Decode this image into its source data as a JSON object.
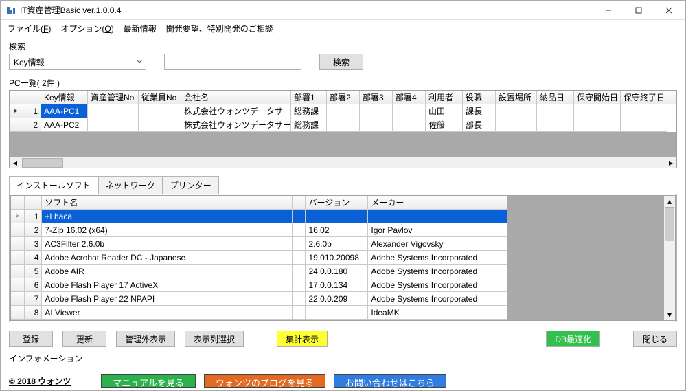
{
  "window": {
    "title": "IT資産管理Basic ver.1.0.0.4"
  },
  "menu": {
    "file": "ファイル(F)",
    "option": "オプション(O)",
    "latest": "最新情報",
    "request": "開発要望、特別開発のご相談"
  },
  "search": {
    "label": "検索",
    "combo_value": "Key情報",
    "text_value": "",
    "button": "検索"
  },
  "pc_list": {
    "title": "PC一覧( 2件 )",
    "columns": [
      "Key情報",
      "資産管理No",
      "従業員No",
      "会社名",
      "部署1",
      "部署2",
      "部署3",
      "部署4",
      "利用者",
      "役職",
      "設置場所",
      "納品日",
      "保守開始日",
      "保守終了日"
    ],
    "rows": [
      {
        "n": "1",
        "key": "AAA-PC1",
        "asset": "",
        "emp": "",
        "company": "株式会社ウォンツデータサービス",
        "d1": "総務課",
        "d2": "",
        "d3": "",
        "d4": "",
        "user": "山田",
        "role": "課長",
        "loc": "",
        "deliv": "",
        "hs": "",
        "he": ""
      },
      {
        "n": "2",
        "key": "AAA-PC2",
        "asset": "",
        "emp": "",
        "company": "株式会社ウォンツデータサービス",
        "d1": "総務課",
        "d2": "",
        "d3": "",
        "d4": "",
        "user": "佐藤",
        "role": "部長",
        "loc": "",
        "deliv": "",
        "hs": "",
        "he": ""
      }
    ]
  },
  "tabs": {
    "installed": "インストールソフト",
    "network": "ネットワーク",
    "printer": "プリンター"
  },
  "software": {
    "columns": [
      "ソフト名",
      "",
      "バージョン",
      "メーカー"
    ],
    "rows": [
      {
        "n": "1",
        "name": "+Lhaca",
        "ver": "",
        "maker": ""
      },
      {
        "n": "2",
        "name": "7-Zip 16.02 (x64)",
        "ver": "16.02",
        "maker": "Igor Pavlov"
      },
      {
        "n": "3",
        "name": "AC3Filter 2.6.0b",
        "ver": "2.6.0b",
        "maker": "Alexander Vigovsky"
      },
      {
        "n": "4",
        "name": "Adobe Acrobat Reader DC - Japanese",
        "ver": "19.010.20098",
        "maker": "Adobe Systems Incorporated"
      },
      {
        "n": "5",
        "name": "Adobe AIR",
        "ver": "24.0.0.180",
        "maker": "Adobe Systems Incorporated"
      },
      {
        "n": "6",
        "name": "Adobe Flash Player 17 ActiveX",
        "ver": "17.0.0.134",
        "maker": "Adobe Systems Incorporated"
      },
      {
        "n": "7",
        "name": "Adobe Flash Player 22 NPAPI",
        "ver": "22.0.0.209",
        "maker": "Adobe Systems Incorporated"
      },
      {
        "n": "8",
        "name": "AI Viewer",
        "ver": "",
        "maker": "IdeaMK"
      }
    ]
  },
  "buttons": {
    "register": "登録",
    "update": "更新",
    "exclude": "管理外表示",
    "columns": "表示列選択",
    "summary": "集計表示",
    "optimize": "DB最適化",
    "close": "閉じる"
  },
  "info_label": "インフォメーション",
  "copyright": "© 2018 ウォンツ",
  "links": {
    "manual": "マニュアルを見る",
    "blog": "ウォンツのブログを見る",
    "contact": "お問い合わせはこちら"
  }
}
